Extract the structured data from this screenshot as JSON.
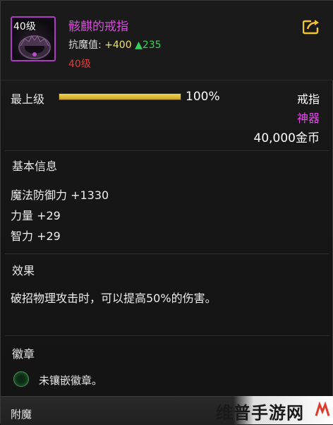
{
  "item": {
    "level_badge": "40级",
    "name": "骸麒的戒指",
    "stat_label": "抗魔值:",
    "stat_value": "+400",
    "stat_up": "▲235",
    "level_req": "40级",
    "icon": "ring-icon"
  },
  "share": {
    "icon": "share-icon"
  },
  "grade": {
    "label": "最上级",
    "percent_text": "100%",
    "fill_fraction": 1.0
  },
  "meta": {
    "type": "戒指",
    "rarity": "神器",
    "price": "40,000金币"
  },
  "basic_info": {
    "title": "基本信息",
    "lines": [
      "魔法防御力 +1330",
      "力量 +29",
      "智力 +29"
    ]
  },
  "effect": {
    "title": "效果",
    "text": "破招物理攻击时，可以提高50%的伤害。"
  },
  "emblem": {
    "title": "徽章",
    "empty_text": "未镶嵌徽章。"
  },
  "enchant": {
    "title": "附魔"
  },
  "watermark": {
    "text": "维普手游网"
  },
  "colors": {
    "rarity": "#e04ae6",
    "item_name": "#d94adf",
    "level_req": "#e23a3a",
    "stat_up": "#34d25c",
    "grade_fill": "#e0b83a"
  }
}
